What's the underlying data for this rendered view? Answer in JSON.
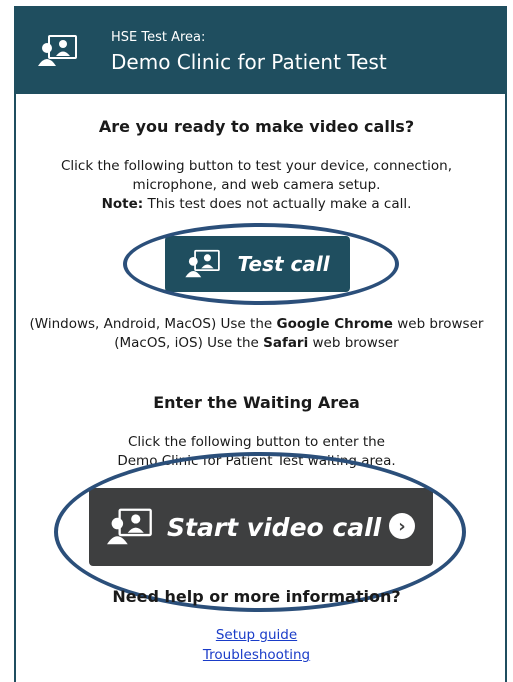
{
  "header": {
    "area_label": "HSE Test Area:",
    "clinic_name": "Demo Clinic for Patient Test",
    "logo_icon": "video-people-icon"
  },
  "ready_section": {
    "heading": "Are you ready to make video calls?",
    "intro_line1": "Click the following button to test your device, connection,",
    "intro_line2": "microphone, and web camera setup.",
    "note_label": "Note:",
    "note_text": " This test does not actually make a call.",
    "test_button_label": "Test call",
    "browser_line1_prefix": "(Windows, Android, MacOS) Use the ",
    "browser_line1_bold": "Google Chrome",
    "browser_line1_suffix": " web browser",
    "browser_line2_prefix": "(MacOS, iOS) Use the ",
    "browser_line2_bold": "Safari",
    "browser_line2_suffix": " web browser"
  },
  "waiting_section": {
    "heading": "Enter the Waiting Area",
    "intro_line1": "Click the following button to enter the",
    "intro_line2": "Demo Clinic for Patient Test waiting area.",
    "start_button_label": "Start video call"
  },
  "help_section": {
    "heading": "Need help or more information?",
    "links": [
      "Setup guide",
      "Troubleshooting"
    ]
  },
  "colors": {
    "header_bg": "#1f4e5f",
    "start_button_bg": "#3e3f40",
    "annotation_oval": "#2b4f7a",
    "link": "#1a3cc8"
  }
}
